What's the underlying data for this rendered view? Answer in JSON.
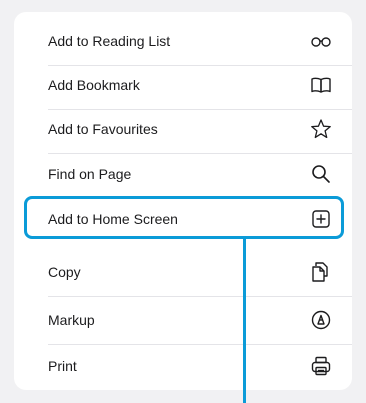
{
  "menu": {
    "items": [
      {
        "label": "Add to Reading List",
        "icon": "reading-glasses-icon"
      },
      {
        "label": "Add Bookmark",
        "icon": "open-book-icon"
      },
      {
        "label": "Add to Favourites",
        "icon": "star-icon"
      },
      {
        "label": "Find on Page",
        "icon": "magnifier-icon"
      },
      {
        "label": "Add to Home Screen",
        "icon": "plus-square-icon"
      },
      {
        "label": "Copy",
        "icon": "copy-documents-icon"
      },
      {
        "label": "Markup",
        "icon": "markup-pen-icon"
      },
      {
        "label": "Print",
        "icon": "printer-icon"
      }
    ]
  },
  "annotation": {
    "highlighted_item": "Add to Home Screen",
    "color": "#0b9bd8"
  }
}
